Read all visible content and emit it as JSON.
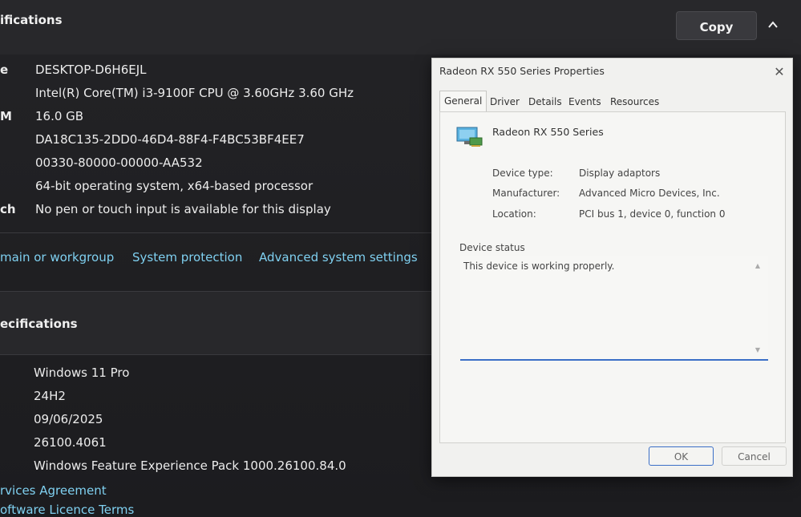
{
  "device_specs": {
    "header": "ifications",
    "copy_label": "Copy",
    "rows": [
      {
        "label": "e",
        "value": "DESKTOP-D6H6EJL"
      },
      {
        "label": "",
        "value": "Intel(R) Core(TM) i3-9100F CPU @ 3.60GHz   3.60 GHz"
      },
      {
        "label": "M",
        "value": "16.0 GB"
      },
      {
        "label": "",
        "value": "DA18C135-2DD0-46D4-88F4-F4BC53BF4EE7"
      },
      {
        "label": "",
        "value": "00330-80000-00000-AA532"
      },
      {
        "label": "",
        "value": "64-bit operating system, x64-based processor"
      },
      {
        "label": "ch",
        "value": "No pen or touch input is available for this display"
      }
    ]
  },
  "related_links": {
    "domain": "main or workgroup",
    "protection": "System protection",
    "advanced": "Advanced system settings"
  },
  "windows_specs": {
    "header": "ecifications",
    "rows": [
      "Windows 11 Pro",
      "24H2",
      "09/06/2025",
      "26100.4061",
      "Windows Feature Experience Pack 1000.26100.84.0"
    ],
    "links": [
      "rvices Agreement",
      "oftware Licence Terms"
    ]
  },
  "dialog": {
    "title": "Radeon RX 550 Series Properties",
    "close_glyph": "✕",
    "tabs": [
      "General",
      "Driver",
      "Details",
      "Events",
      "Resources"
    ],
    "active_tab": "General",
    "device_name": "Radeon RX 550 Series",
    "properties": [
      {
        "label": "Device type:",
        "value": "Display adaptors"
      },
      {
        "label": "Manufacturer:",
        "value": "Advanced Micro Devices, Inc."
      },
      {
        "label": "Location:",
        "value": "PCI bus 1, device 0, function 0"
      }
    ],
    "status_label": "Device status",
    "status_text": "This device is working properly.",
    "ok_label": "OK",
    "cancel_label": "Cancel"
  },
  "icons": {
    "chevron": "chevron-up-icon",
    "device": "display-adapter-icon"
  },
  "colors": {
    "link": "#7fd0f0",
    "accent": "#3b6fc7"
  }
}
